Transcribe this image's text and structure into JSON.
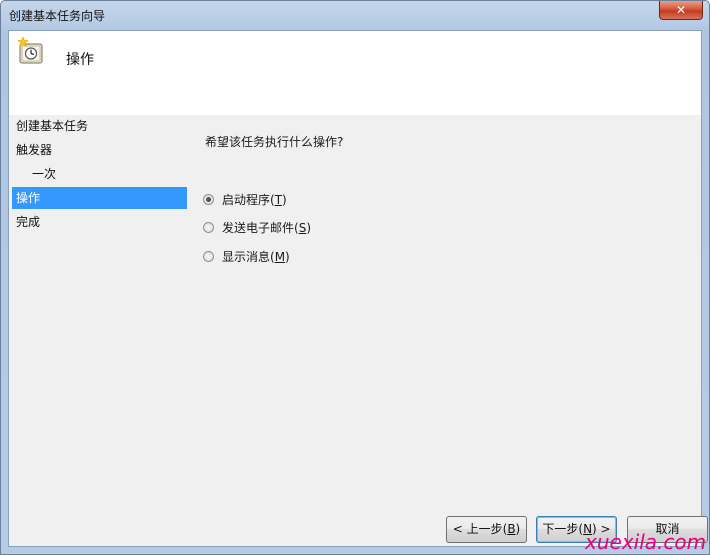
{
  "window": {
    "title": "创建基本任务向导",
    "close_label": "✕"
  },
  "header": {
    "title": "操作",
    "icon": "task-clock-icon"
  },
  "steps": [
    {
      "label": "创建基本任务",
      "indent": false,
      "active": false
    },
    {
      "label": "触发器",
      "indent": false,
      "active": false
    },
    {
      "label": "一次",
      "indent": true,
      "active": false
    },
    {
      "label": "操作",
      "indent": false,
      "active": true
    },
    {
      "label": "完成",
      "indent": false,
      "active": false
    }
  ],
  "main": {
    "question": "希望该任务执行什么操作?",
    "options": [
      {
        "label_prefix": "启动程序(",
        "mnemonic": "T",
        "label_suffix": ")",
        "checked": true
      },
      {
        "label_prefix": "发送电子邮件(",
        "mnemonic": "S",
        "label_suffix": ")",
        "checked": false
      },
      {
        "label_prefix": "显示消息(",
        "mnemonic": "M",
        "label_suffix": ")",
        "checked": false
      }
    ]
  },
  "buttons": {
    "back": {
      "prefix": "< 上一步(",
      "mnemonic": "B",
      "suffix": ")"
    },
    "next": {
      "prefix": "下一步(",
      "mnemonic": "N",
      "suffix": ") >"
    },
    "cancel": {
      "label": "取消"
    }
  },
  "watermark": "xuexila.com",
  "colors": {
    "selection": "#3399ff",
    "watermark": "#e6007e"
  }
}
